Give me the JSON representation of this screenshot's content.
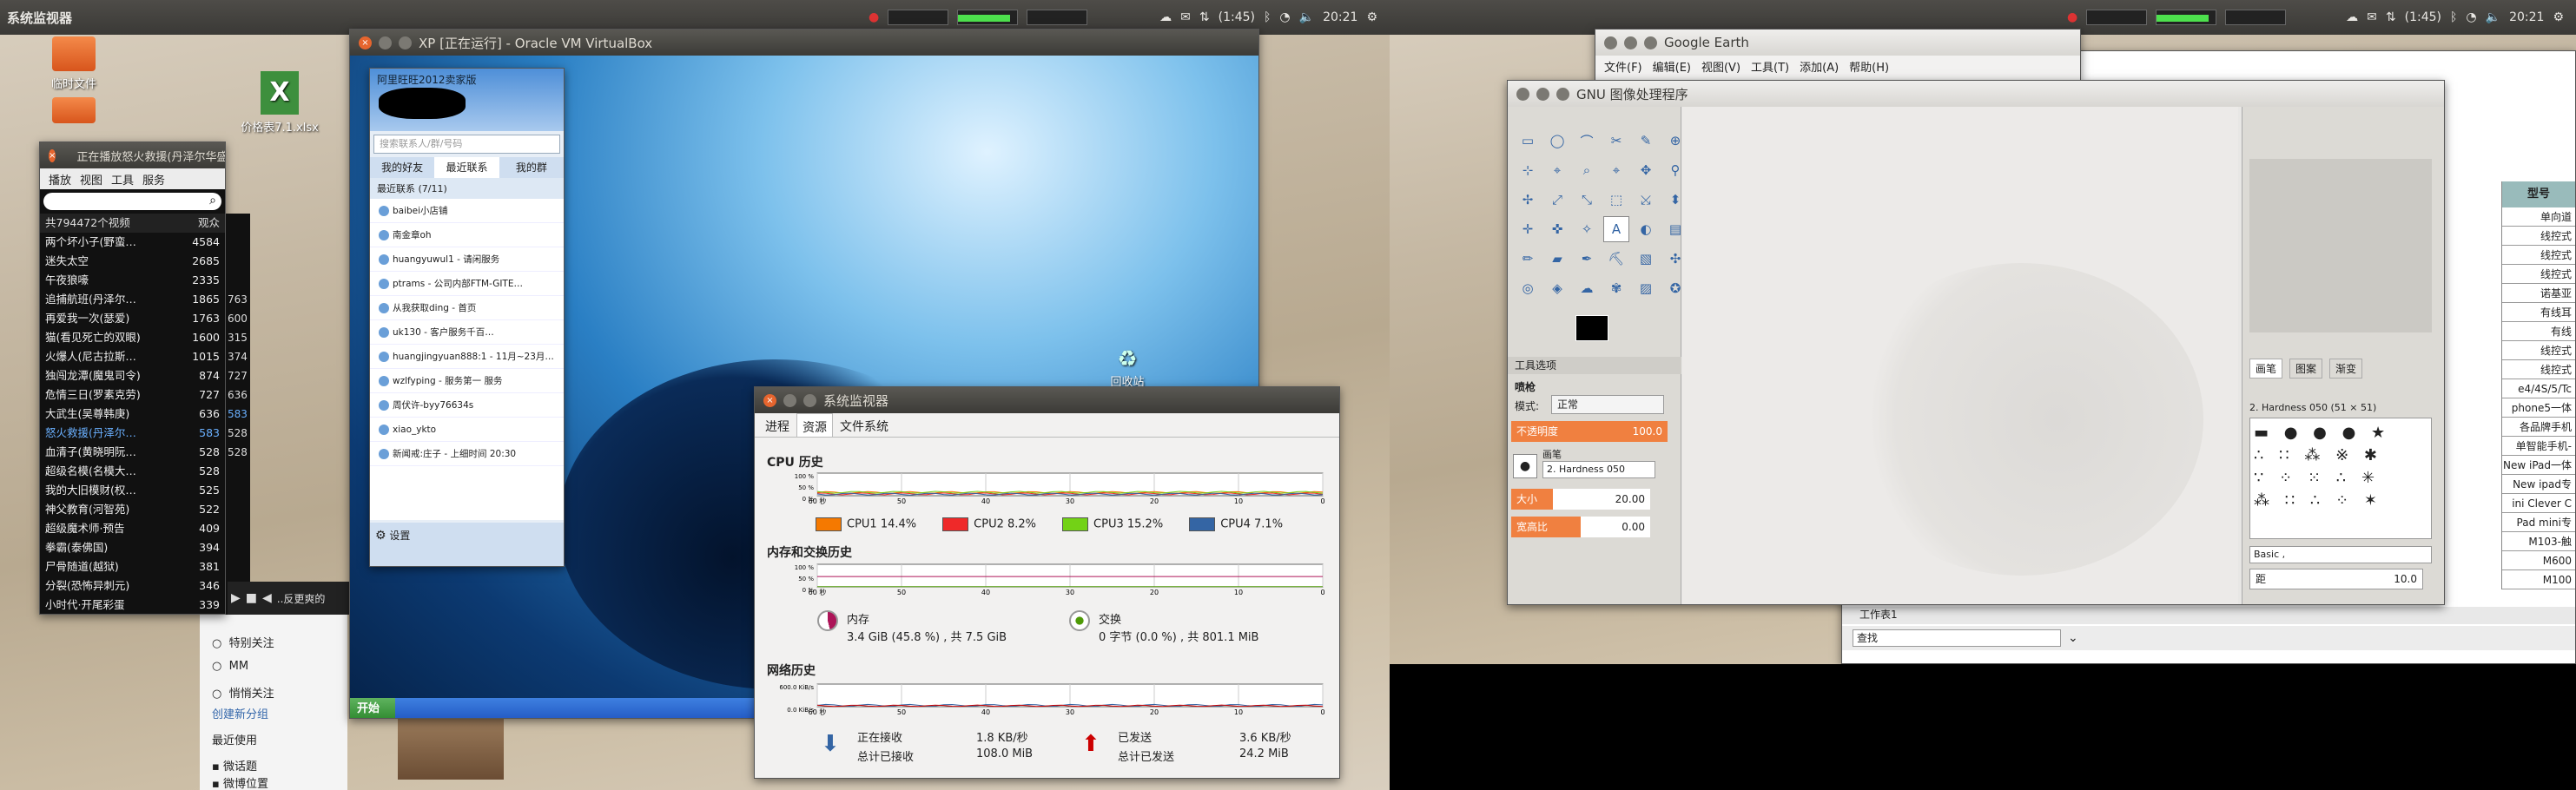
{
  "left_panel": {
    "app_title": "系统监视器",
    "time": "20:21",
    "volume": "(1:45)"
  },
  "right_panel": {
    "time": "20:21",
    "volume": "(1:45)"
  },
  "desktop": {
    "folder_label": "临时文件",
    "xlsx_label": "价格表7.1.xlsx",
    "xlsx_letter": "X"
  },
  "player": {
    "title": "正在播放怒火救援(丹泽尔华盛顿)",
    "menu": [
      "播放",
      "视图",
      "工具",
      "服务"
    ],
    "count_label": "共794472个视频",
    "col_viewers": "观众",
    "items": [
      [
        "两个坏小子(野蛮…",
        "4584",
        ""
      ],
      [
        "迷失太空",
        "2685",
        ""
      ],
      [
        "午夜狼嚎",
        "2335",
        ""
      ],
      [
        "追捕航班(丹泽尔…",
        "1865",
        ""
      ],
      [
        "再爱我一次(瑟爱)",
        "1763",
        "763"
      ],
      [
        "猫(看见死亡的双眼)",
        "1600",
        "600"
      ],
      [
        "火爆人(尼古拉斯…",
        "1015",
        "315"
      ],
      [
        "独闯龙潭(魔鬼司令)",
        "874",
        "374"
      ],
      [
        "危情三日(罗素克劳)",
        "727",
        "727"
      ],
      [
        "大武生(吴尊韩庚)",
        "636",
        "636"
      ],
      [
        "怒火救援(丹泽尔…",
        "583",
        "583"
      ],
      [
        "血清子(黄晓明阮…",
        "528",
        "528"
      ],
      [
        "超级名模(名模大…",
        "528",
        "528"
      ],
      [
        "我的大旧模财(权…",
        "525",
        ""
      ],
      [
        "神父教育(河智苑)",
        "522",
        ""
      ],
      [
        "超级魔术师·预告",
        "409",
        ""
      ],
      [
        "拳霸(泰佛国)",
        "394",
        ""
      ],
      [
        "尸骨随道(越狱)",
        "381",
        ""
      ],
      [
        "分裂(恐怖异刺元)",
        "346",
        ""
      ],
      [
        "小时代·开尾彩蛋",
        "339",
        ""
      ]
    ],
    "footer_text": "..反更爽的"
  },
  "vbox": {
    "title": "XP [正在运行] - Oracle VM VirtualBox",
    "recycle": "回收站",
    "start": "开始"
  },
  "qq": {
    "title": "阿里旺旺2012卖家版",
    "search": "搜索联系人/群/号码",
    "tabs": [
      "我的好友",
      "最近联系",
      "我的群"
    ],
    "group": "最近联系 (7/11)",
    "contacts": [
      "baibei小店铺",
      "南金章oh",
      "huangyuwul1 - 请闲服务",
      "ptrams - 公司内部FTM-GITE…",
      "从我获取ding - 首页",
      "uk130 - 客户服务千百…",
      "huangjingyuan888:1 - 11月~23月…",
      "wzlfyping - 服务第一 服务",
      "周伏许-byy76634s",
      "xiao_ykto",
      "新闻戒:庄子 - 上细时间 20:30"
    ],
    "settings": "设置"
  },
  "side": {
    "items": [
      "特别关注",
      "MM",
      "悄悄关注"
    ],
    "create_group": "创建新分组",
    "recent": "最近使用",
    "links": [
      "微话题",
      "微博位置"
    ]
  },
  "sysmon": {
    "title": "系统监视器",
    "tabs": [
      "进程",
      "资源",
      "文件系统"
    ],
    "cpu_title": "CPU 历史",
    "cpu": [
      {
        "name": "CPU1",
        "value": "14.4%",
        "color": "#f57900"
      },
      {
        "name": "CPU2",
        "value": "8.2%",
        "color": "#ef2929"
      },
      {
        "name": "CPU3",
        "value": "15.2%",
        "color": "#73d216"
      },
      {
        "name": "CPU4",
        "value": "7.1%",
        "color": "#3465a4"
      }
    ],
    "ticks": [
      "60 秒",
      "50",
      "40",
      "30",
      "20",
      "10",
      "0"
    ],
    "pct": [
      "100 %",
      "50 %",
      "0 %"
    ],
    "mem_title": "内存和交换历史",
    "mem_label": "内存",
    "mem_value": "3.4 GiB (45.8 %) , 共 7.5 GiB",
    "swap_label": "交换",
    "swap_value": "0 字节 (0.0 %) , 共 801.1 MiB",
    "net_title": "网络历史",
    "net_axis": [
      "600.0 KiB/s",
      "0.0 KiB/s"
    ],
    "recv_label": "正在接收",
    "recv_rate": "1.8 KB/秒",
    "recv_total_label": "总计已接收",
    "recv_total": "108.0 MiB",
    "send_label": "已发送",
    "send_rate": "3.6 KB/秒",
    "send_total_label": "总计已发送",
    "send_total": "24.2 MiB"
  },
  "gearth": {
    "title": "Google Earth",
    "menu": [
      "文件(F)",
      "编辑(E)",
      "视图(V)",
      "工具(T)",
      "添加(A)",
      "帮助(H)"
    ]
  },
  "gimp": {
    "title": "GNU 图像处理程序",
    "tool_options": "工具选项",
    "paint": "喷枪",
    "mode_label": "模式:",
    "mode": "正常",
    "opacity_label": "不透明度",
    "opacity": "100.0",
    "brush_label": "画笔",
    "brush": "2. Hardness 050",
    "size_label": "大小",
    "size": "20.00",
    "ratio_label": "宽高比",
    "ratio": "0.00",
    "tabs": [
      "画笔",
      "图案",
      "渐变"
    ],
    "brush_name": "2. Hardness 050 (51 × 51)",
    "preset": "Basic ,",
    "spacing_label": "距",
    "spacing": "10.0"
  },
  "sheet": {
    "title_cell": "型号",
    "cells": [
      "单向道",
      "线控式",
      "线控式",
      "线控式",
      "诺基亚",
      "有线耳",
      "有线",
      "线控式",
      "线控式",
      "e4/4S/5/Tc",
      "phone5一体",
      "各品牌手机",
      "单智能手机-",
      "New iPad一体",
      "New ipad专",
      "ini Clever C",
      "Pad mini专",
      "M103-触",
      "M600",
      "M100"
    ],
    "tab": "工作表1",
    "find_label": "查找"
  }
}
